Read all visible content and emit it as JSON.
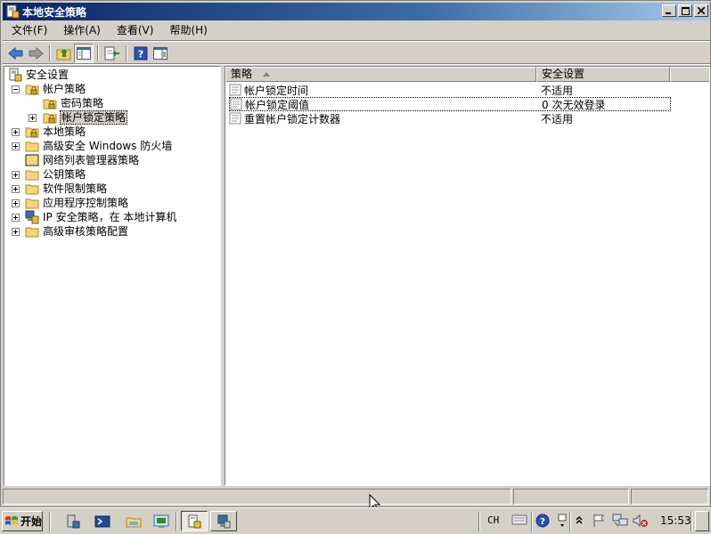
{
  "window": {
    "title": "本地安全策略",
    "controls": [
      "minimize-icon",
      "restore-icon",
      "close-icon"
    ]
  },
  "menubar": {
    "items": [
      "文件(F)",
      "操作(A)",
      "查看(V)",
      "帮助(H)"
    ]
  },
  "toolbar": {
    "icons": [
      "back-arrow-icon",
      "forward-arrow-icon",
      "up-folder-icon",
      "show-hide-tree-icon",
      "export-list-icon",
      "help-icon",
      "action-pane-icon"
    ]
  },
  "tree": {
    "nodes": [
      {
        "label": "安全设置",
        "icon": "security-settings-icon",
        "level": 0
      },
      {
        "label": "帐户策略",
        "icon": "folder-lock-icon",
        "level": 1,
        "expanded": true
      },
      {
        "label": "密码策略",
        "icon": "folder-lock-icon",
        "level": 2
      },
      {
        "label": "帐户锁定策略",
        "icon": "folder-lock-icon",
        "level": 2,
        "selected": true,
        "expandable": true
      },
      {
        "label": "本地策略",
        "icon": "folder-lock-icon",
        "level": 1,
        "expandable": true
      },
      {
        "label": "高级安全 Windows 防火墙",
        "icon": "folder-icon",
        "level": 1,
        "expandable": true
      },
      {
        "label": "网络列表管理器策略",
        "icon": "folder-icon",
        "level": 1
      },
      {
        "label": "公钥策略",
        "icon": "folder-icon",
        "level": 1,
        "expandable": true
      },
      {
        "label": "软件限制策略",
        "icon": "folder-icon",
        "level": 1,
        "expandable": true
      },
      {
        "label": "应用程序控制策略",
        "icon": "folder-icon",
        "level": 1,
        "expandable": true
      },
      {
        "label": "IP 安全策略，在 本地计算机",
        "icon": "ip-security-icon",
        "level": 1,
        "expandable": true
      },
      {
        "label": "高级审核策略配置",
        "icon": "folder-icon",
        "level": 1,
        "expandable": true
      }
    ]
  },
  "list": {
    "columns": [
      "策略",
      "安全设置"
    ],
    "sort_column": "策略",
    "rows": [
      {
        "name": "帐户锁定时间",
        "value": "不适用"
      },
      {
        "name": "帐户锁定阈值",
        "value": "0 次无效登录",
        "focused": true
      },
      {
        "name": "重置帐户锁定计数器",
        "value": "不适用"
      }
    ]
  },
  "taskbar": {
    "start_label": "开始",
    "language": "CH",
    "clock": "15:53"
  }
}
